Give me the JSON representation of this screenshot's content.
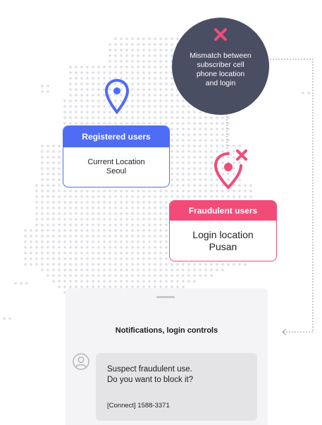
{
  "mismatch": {
    "line1": "Mismatch between",
    "line2": "subscriber cell",
    "line3": "phone location",
    "line4": "and login"
  },
  "registered": {
    "title": "Registered users",
    "label": "Current Location",
    "city": "Seoul"
  },
  "fraudulent": {
    "title": "Fraudulent users",
    "label": "Login location",
    "city": "Pusan"
  },
  "notification": {
    "title": "Notifications, login controls",
    "message_line1": "Suspect fraudulent use.",
    "message_line2": "Do you want to block it?",
    "contact": "[Connect] 1588-3371"
  },
  "colors": {
    "registered": "#4f6cf5",
    "fraudulent": "#f24b78",
    "mismatch_bg": "#4a4e62",
    "map_dots": "#dcdde6"
  },
  "icons": {
    "registered_pin": "location-pin-icon",
    "fraud_pin": "location-pin-x-icon",
    "mismatch_mark": "x-mark-icon",
    "user_avatar": "user-avatar-icon"
  }
}
